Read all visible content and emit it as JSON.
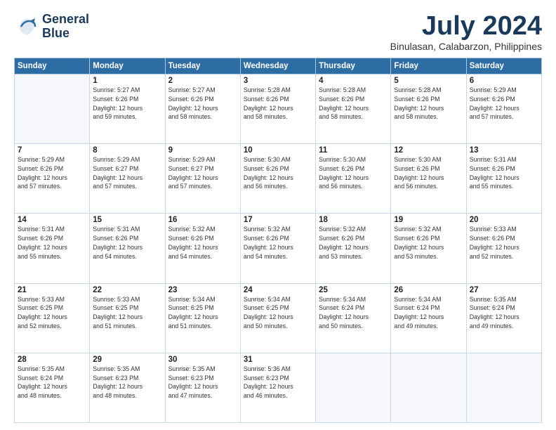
{
  "header": {
    "logo_line1": "General",
    "logo_line2": "Blue",
    "month": "July 2024",
    "location": "Binulasan, Calabarzon, Philippines"
  },
  "weekdays": [
    "Sunday",
    "Monday",
    "Tuesday",
    "Wednesday",
    "Thursday",
    "Friday",
    "Saturday"
  ],
  "weeks": [
    [
      {
        "day": "",
        "info": ""
      },
      {
        "day": "1",
        "info": "Sunrise: 5:27 AM\nSunset: 6:26 PM\nDaylight: 12 hours\nand 59 minutes."
      },
      {
        "day": "2",
        "info": "Sunrise: 5:27 AM\nSunset: 6:26 PM\nDaylight: 12 hours\nand 58 minutes."
      },
      {
        "day": "3",
        "info": "Sunrise: 5:28 AM\nSunset: 6:26 PM\nDaylight: 12 hours\nand 58 minutes."
      },
      {
        "day": "4",
        "info": "Sunrise: 5:28 AM\nSunset: 6:26 PM\nDaylight: 12 hours\nand 58 minutes."
      },
      {
        "day": "5",
        "info": "Sunrise: 5:28 AM\nSunset: 6:26 PM\nDaylight: 12 hours\nand 58 minutes."
      },
      {
        "day": "6",
        "info": "Sunrise: 5:29 AM\nSunset: 6:26 PM\nDaylight: 12 hours\nand 57 minutes."
      }
    ],
    [
      {
        "day": "7",
        "info": "Sunrise: 5:29 AM\nSunset: 6:26 PM\nDaylight: 12 hours\nand 57 minutes."
      },
      {
        "day": "8",
        "info": "Sunrise: 5:29 AM\nSunset: 6:27 PM\nDaylight: 12 hours\nand 57 minutes."
      },
      {
        "day": "9",
        "info": "Sunrise: 5:29 AM\nSunset: 6:27 PM\nDaylight: 12 hours\nand 57 minutes."
      },
      {
        "day": "10",
        "info": "Sunrise: 5:30 AM\nSunset: 6:26 PM\nDaylight: 12 hours\nand 56 minutes."
      },
      {
        "day": "11",
        "info": "Sunrise: 5:30 AM\nSunset: 6:26 PM\nDaylight: 12 hours\nand 56 minutes."
      },
      {
        "day": "12",
        "info": "Sunrise: 5:30 AM\nSunset: 6:26 PM\nDaylight: 12 hours\nand 56 minutes."
      },
      {
        "day": "13",
        "info": "Sunrise: 5:31 AM\nSunset: 6:26 PM\nDaylight: 12 hours\nand 55 minutes."
      }
    ],
    [
      {
        "day": "14",
        "info": "Sunrise: 5:31 AM\nSunset: 6:26 PM\nDaylight: 12 hours\nand 55 minutes."
      },
      {
        "day": "15",
        "info": "Sunrise: 5:31 AM\nSunset: 6:26 PM\nDaylight: 12 hours\nand 54 minutes."
      },
      {
        "day": "16",
        "info": "Sunrise: 5:32 AM\nSunset: 6:26 PM\nDaylight: 12 hours\nand 54 minutes."
      },
      {
        "day": "17",
        "info": "Sunrise: 5:32 AM\nSunset: 6:26 PM\nDaylight: 12 hours\nand 54 minutes."
      },
      {
        "day": "18",
        "info": "Sunrise: 5:32 AM\nSunset: 6:26 PM\nDaylight: 12 hours\nand 53 minutes."
      },
      {
        "day": "19",
        "info": "Sunrise: 5:32 AM\nSunset: 6:26 PM\nDaylight: 12 hours\nand 53 minutes."
      },
      {
        "day": "20",
        "info": "Sunrise: 5:33 AM\nSunset: 6:26 PM\nDaylight: 12 hours\nand 52 minutes."
      }
    ],
    [
      {
        "day": "21",
        "info": "Sunrise: 5:33 AM\nSunset: 6:25 PM\nDaylight: 12 hours\nand 52 minutes."
      },
      {
        "day": "22",
        "info": "Sunrise: 5:33 AM\nSunset: 6:25 PM\nDaylight: 12 hours\nand 51 minutes."
      },
      {
        "day": "23",
        "info": "Sunrise: 5:34 AM\nSunset: 6:25 PM\nDaylight: 12 hours\nand 51 minutes."
      },
      {
        "day": "24",
        "info": "Sunrise: 5:34 AM\nSunset: 6:25 PM\nDaylight: 12 hours\nand 50 minutes."
      },
      {
        "day": "25",
        "info": "Sunrise: 5:34 AM\nSunset: 6:24 PM\nDaylight: 12 hours\nand 50 minutes."
      },
      {
        "day": "26",
        "info": "Sunrise: 5:34 AM\nSunset: 6:24 PM\nDaylight: 12 hours\nand 49 minutes."
      },
      {
        "day": "27",
        "info": "Sunrise: 5:35 AM\nSunset: 6:24 PM\nDaylight: 12 hours\nand 49 minutes."
      }
    ],
    [
      {
        "day": "28",
        "info": "Sunrise: 5:35 AM\nSunset: 6:24 PM\nDaylight: 12 hours\nand 48 minutes."
      },
      {
        "day": "29",
        "info": "Sunrise: 5:35 AM\nSunset: 6:23 PM\nDaylight: 12 hours\nand 48 minutes."
      },
      {
        "day": "30",
        "info": "Sunrise: 5:35 AM\nSunset: 6:23 PM\nDaylight: 12 hours\nand 47 minutes."
      },
      {
        "day": "31",
        "info": "Sunrise: 5:36 AM\nSunset: 6:23 PM\nDaylight: 12 hours\nand 46 minutes."
      },
      {
        "day": "",
        "info": ""
      },
      {
        "day": "",
        "info": ""
      },
      {
        "day": "",
        "info": ""
      }
    ]
  ]
}
